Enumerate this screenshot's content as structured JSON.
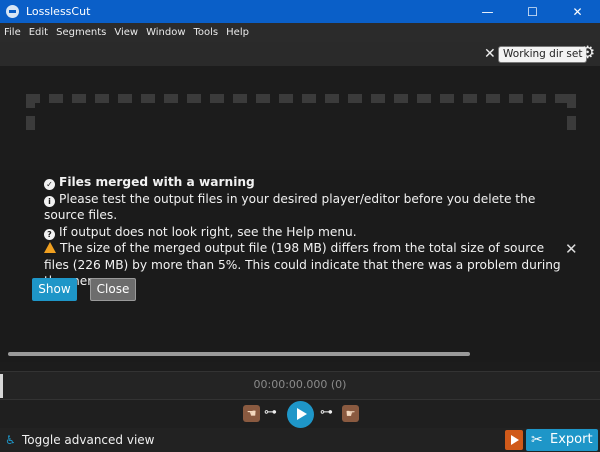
{
  "window": {
    "title": "LosslessCut",
    "controls": {
      "minimize": "—",
      "maximize": "☐",
      "close": "✕"
    },
    "accent": "#0a5fc8"
  },
  "menubar": {
    "items": [
      "File",
      "Edit",
      "Segments",
      "View",
      "Window",
      "Tools",
      "Help"
    ]
  },
  "toolbar": {
    "working_dir_label": "Working dir set",
    "clear_icon": "close-icon",
    "settings_icon": "gear-icon"
  },
  "notification": {
    "title": "Files merged with a warning",
    "line1": "Please test the output files in your desired player/editor before you delete the source files.",
    "line2": "If output does not look right, see the Help menu.",
    "warning": "The size of the merged output file (198 MB) differs from the total size of source files (226 MB) by more than 5%. This could indicate that there was a problem during the merge.",
    "show_label": "Show",
    "close_label": "Close",
    "accent": "#1e96c8"
  },
  "timeline": {
    "timecode": "00:00:00.000 (0)"
  },
  "controls": {
    "play_icon": "play-icon"
  },
  "bottombar": {
    "advanced_label": "Toggle advanced view",
    "export_label": "Export",
    "export_format_color": "#d05a1a"
  }
}
